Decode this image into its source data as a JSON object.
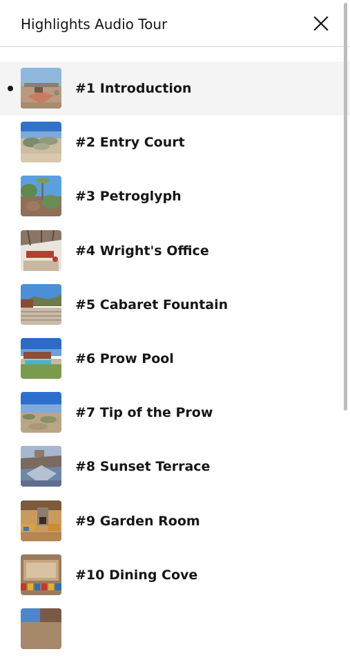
{
  "header": {
    "title": "Highlights Audio Tour",
    "close_icon": "close-icon"
  },
  "stops": [
    {
      "label": "#1 Introduction",
      "active": true,
      "thumb": "stop-1-thumbnail"
    },
    {
      "label": "#2 Entry Court",
      "active": false,
      "thumb": "stop-2-thumbnail"
    },
    {
      "label": "#3 Petroglyph",
      "active": false,
      "thumb": "stop-3-thumbnail"
    },
    {
      "label": "#4 Wright's Office",
      "active": false,
      "thumb": "stop-4-thumbnail"
    },
    {
      "label": "#5 Cabaret Fountain",
      "active": false,
      "thumb": "stop-5-thumbnail"
    },
    {
      "label": "#6 Prow Pool",
      "active": false,
      "thumb": "stop-6-thumbnail"
    },
    {
      "label": "#7 Tip of the Prow",
      "active": false,
      "thumb": "stop-7-thumbnail"
    },
    {
      "label": "#8 Sunset Terrace",
      "active": false,
      "thumb": "stop-8-thumbnail"
    },
    {
      "label": "#9 Garden Room",
      "active": false,
      "thumb": "stop-9-thumbnail"
    },
    {
      "label": "#10 Dining Cove",
      "active": false,
      "thumb": "stop-10-thumbnail"
    },
    {
      "label": "",
      "active": false,
      "thumb": "stop-11-thumbnail"
    }
  ],
  "colors": {
    "active_row_bg": "#f4f4f4",
    "text": "#161616",
    "divider": "#d9d9d9",
    "scrollbar": "#bdbdbd"
  }
}
